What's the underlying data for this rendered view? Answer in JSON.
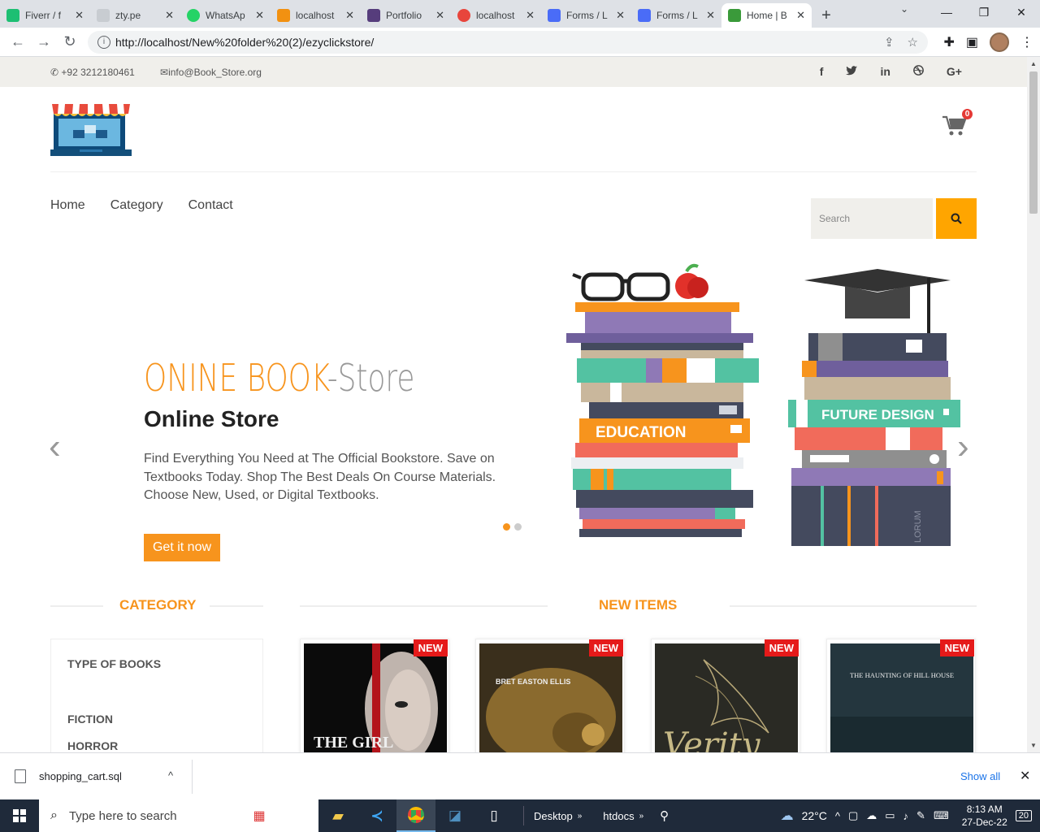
{
  "browser": {
    "tabs": [
      {
        "label": "Fiverr / f",
        "color": "#1dbf73"
      },
      {
        "label": "zty.pe",
        "color": "#9aa0a6"
      },
      {
        "label": "WhatsAp",
        "color": "#25d366"
      },
      {
        "label": "localhost",
        "color": "#f29111"
      },
      {
        "label": "Portfolio",
        "color": "#563d7c"
      },
      {
        "label": "localhost",
        "color": "#e8453c"
      },
      {
        "label": "Forms / L",
        "color": "#4a6cf7"
      },
      {
        "label": "Forms / L",
        "color": "#4a6cf7"
      },
      {
        "label": "Home | B",
        "color": "#3a9a3a"
      }
    ],
    "url": "http://localhost/New%20folder%20(2)/ezyclickstore/"
  },
  "site": {
    "phone": "+92 3212180461",
    "email": "info@Book_Store.org",
    "social": [
      "f",
      "t",
      "in",
      "dribbble",
      "G+"
    ],
    "cart_count": "0",
    "nav": [
      "Home",
      "Category",
      "Contact"
    ],
    "search_placeholder": "Search",
    "hero": {
      "title_main": "ONINE BOOK",
      "title_rest": "-Store",
      "subtitle": "Online Store",
      "description": "Find Everything You Need at The Official Bookstore. Save on Textbooks Today. Shop The Best Deals On Course Materials. Choose New, Used, or Digital Textbooks.",
      "button": "Get it now",
      "art_label_left": "EDUCATION",
      "art_label_right": "FUTURE DESIGN",
      "art_spine_text": "LORUM"
    },
    "sections": {
      "category": "CATEGORY",
      "new_items": "NEW ITEMS"
    },
    "categories": [
      "TYPE OF BOOKS",
      "FICTION",
      "HORROR"
    ],
    "products": [
      {
        "badge": "NEW",
        "cover_text": "THE GIRL",
        "bg": "#0b0b0b"
      },
      {
        "badge": "NEW",
        "cover_text": "BRET EASTON ELLIS",
        "bg": "#3a2f1c"
      },
      {
        "badge": "NEW",
        "cover_text": "Verity",
        "bg": "#2a2a24"
      },
      {
        "badge": "NEW",
        "cover_text": "THE HAUNTING OF HILL HOUSE",
        "bg": "#24363e"
      }
    ]
  },
  "downloads": {
    "file": "shopping_cart.sql",
    "show_all": "Show all"
  },
  "taskbar": {
    "search_placeholder": "Type here to search",
    "desktop": "Desktop",
    "htdocs": "htdocs",
    "weather": "22°C",
    "time": "8:13 AM",
    "date": "27-Dec-22",
    "notif_count": "20"
  }
}
